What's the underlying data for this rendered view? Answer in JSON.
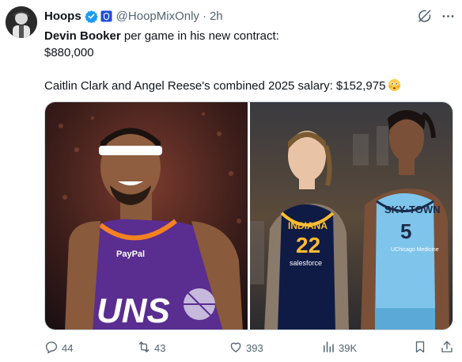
{
  "author": {
    "display_name": "Hoops",
    "handle": "@HoopMixOnly",
    "time": "2h",
    "separator": "·"
  },
  "tweet": {
    "line1_bold": "Devin Booker",
    "line1_rest": " per game in his new contract:",
    "line2": "$880,000",
    "line3": "Caitlin Clark and Angel Reese's combined 2025 salary: $152,975",
    "jersey_left_text": "UNS",
    "jersey_left_sponsor": "PayPal",
    "jersey_mid_team": "INDIANA",
    "jersey_mid_number": "22",
    "jersey_mid_sponsor": "salesforce",
    "jersey_right_team": "SKY·TOWN",
    "jersey_right_number": "5",
    "jersey_right_sponsor": "UChicago Medicine"
  },
  "metrics": {
    "replies": "44",
    "reposts": "43",
    "likes": "393",
    "views": "39K"
  },
  "icons": {
    "verified": "verified-badge-icon",
    "affiliate": "affiliate-badge-icon",
    "grok": "grok-icon",
    "more": "more-icon",
    "reply": "reply-icon",
    "repost": "repost-icon",
    "like": "heart-icon",
    "views": "views-icon",
    "bookmark": "bookmark-icon",
    "share": "share-icon",
    "emoji": "flushed-face-emoji"
  },
  "colors": {
    "accent": "#1d9bf0",
    "muted": "#536471",
    "text": "#0f1419",
    "suns_purple": "#5a2d91",
    "fever_navy": "#0f1b45",
    "sky_blue": "#7fc4ea"
  }
}
